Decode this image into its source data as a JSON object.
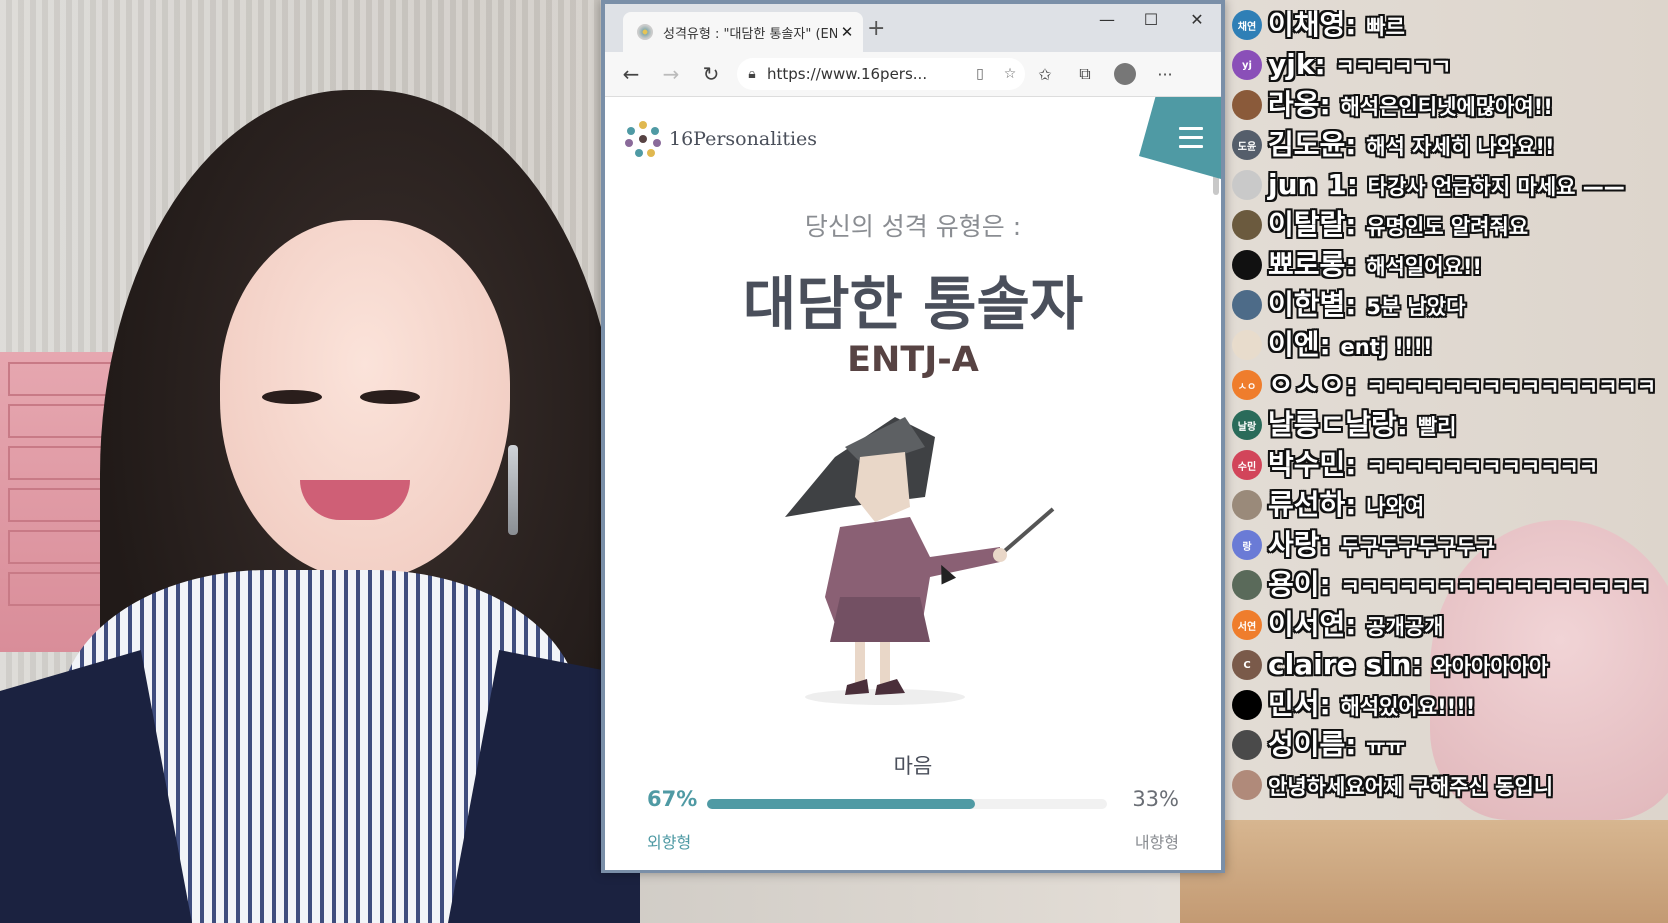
{
  "browser": {
    "tab_title": "성격유형 : \"대담한 통솔자\" (ENTJ",
    "tab_close": "✕",
    "new_tab": "+",
    "window_controls": {
      "minimize": "—",
      "maximize": "☐",
      "close": "✕"
    },
    "nav": {
      "back": "←",
      "forward": "→",
      "refresh": "↻"
    },
    "url": "https://www.16pers...",
    "toolbar_icons": [
      "reader-icon",
      "favorite-star-icon",
      "favorites-list-icon",
      "collections-icon",
      "profile-icon",
      "more-icon"
    ],
    "more_label": "···"
  },
  "page": {
    "logo_text": "16Personalities",
    "subtitle": "당신의 성격 유형은 :",
    "type_name": "대담한 통솔자",
    "type_code": "ENTJ-A",
    "trait": {
      "label": "마음",
      "left_pct_label": "67%",
      "right_pct_label": "33%",
      "left_value": 67,
      "left_side": "외향형",
      "right_side": "내향형"
    }
  },
  "chat": [
    {
      "name": "이채영",
      "msg": "빠르",
      "avatar_text": "채연",
      "avatar_color": "#2f7fb6"
    },
    {
      "name": "yjk",
      "msg": "ㅋㅋㅋㅋㄱㄱ",
      "avatar_text": "yj",
      "avatar_color": "#8a4fb8"
    },
    {
      "name": "라옹",
      "msg": "해석은인티넷에많아여!!",
      "avatar_text": "",
      "avatar_color": "#8a5a3a"
    },
    {
      "name": "김도윤",
      "msg": "해석 자세히 나와요!!",
      "avatar_text": "도윤",
      "avatar_color": "#555e6b"
    },
    {
      "name": "jun 1",
      "msg": "타강사 언급하지 마세요 ——",
      "avatar_text": "",
      "avatar_color": "#c9c9c9"
    },
    {
      "name": "이탈랄",
      "msg": "유명인도 알려줘요",
      "avatar_text": "",
      "avatar_color": "#6b5a3e"
    },
    {
      "name": "뾰로롱",
      "msg": "해석일어요!!",
      "avatar_text": "",
      "avatar_color": "#111111"
    },
    {
      "name": "이한별",
      "msg": "5분 남았다",
      "avatar_text": "",
      "avatar_color": "#4d6b88"
    },
    {
      "name": "이엔",
      "msg": "entj !!!!",
      "avatar_text": "",
      "avatar_color": "#e8dccc"
    },
    {
      "name": "ㅇㅅㅇ",
      "msg": "ㅋㅋㅋㅋㅋㅋㅋㅋㅋㅋㅋㅋㅋㅋㅋ",
      "avatar_text": "ㅅㅇ",
      "avatar_color": "#ef7d2c"
    },
    {
      "name": "날릉ㄷ날랑",
      "msg": "빨리",
      "avatar_text": "날랑",
      "avatar_color": "#2a6b5a"
    },
    {
      "name": "박수민",
      "msg": "ㅋㅋㅋㅋㅋㅋㅋㅋㅋㅋㅋㅋ",
      "avatar_text": "수민",
      "avatar_color": "#d2455a"
    },
    {
      "name": "류선하",
      "msg": "나와여",
      "avatar_text": "",
      "avatar_color": "#9a8a7a"
    },
    {
      "name": "사랑",
      "msg": "두구두구두구두구",
      "avatar_text": "랑",
      "avatar_color": "#6a7bd6"
    },
    {
      "name": "용이",
      "msg": "ㅋㅋㅋㅋㅋㅋㅋㅋㅋㅋㅋㅋㅋㅋㅋㅋ",
      "avatar_text": "",
      "avatar_color": "#5a6a5a"
    },
    {
      "name": "이서연",
      "msg": "공개공개",
      "avatar_text": "서연",
      "avatar_color": "#ef7d2c"
    },
    {
      "name": "claire sin",
      "msg": "와아아아아아",
      "avatar_text": "C",
      "avatar_color": "#7a5a4a"
    },
    {
      "name": "민서",
      "msg": "해석있어요!!!!",
      "avatar_text": "",
      "avatar_color": "#000000"
    },
    {
      "name": "성이름",
      "msg": "ㅠㅠ",
      "avatar_text": "",
      "avatar_color": "#4a4a4a"
    },
    {
      "name": "",
      "msg": "안녕하세요어제 구해주신 동입니",
      "avatar_text": "",
      "avatar_color": "#b08a7a"
    }
  ],
  "colors": {
    "accent": "#4f9aa4",
    "type_name": "#4a4f5b",
    "type_code": "#574343"
  }
}
